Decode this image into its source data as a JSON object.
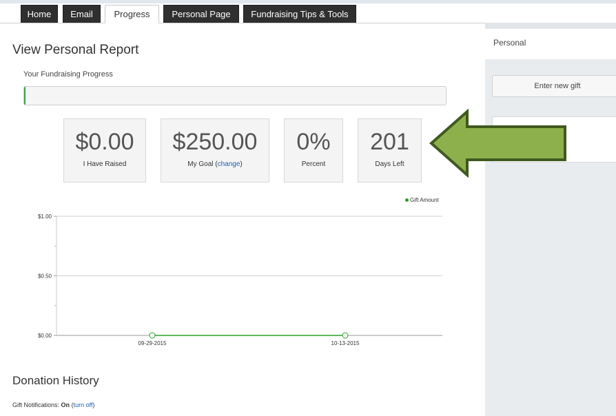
{
  "tabs": [
    {
      "label": "Home",
      "active": false
    },
    {
      "label": "Email",
      "active": false
    },
    {
      "label": "Progress",
      "active": true
    },
    {
      "label": "Personal Page",
      "active": false
    },
    {
      "label": "Fundraising Tips & Tools",
      "active": false
    }
  ],
  "page_title": "View Personal Report",
  "progress": {
    "label": "Your Fundraising Progress",
    "percent_complete": 0
  },
  "stats": {
    "raised": {
      "value": "$0.00",
      "label": "I Have Raised"
    },
    "goal": {
      "value": "$250.00",
      "label_prefix": "My Goal (",
      "link": "change",
      "label_suffix": ")"
    },
    "percent": {
      "value": "0%",
      "label": "Percent"
    },
    "days": {
      "value": "201",
      "label": "Days Left"
    }
  },
  "chart_data": {
    "type": "line",
    "series": [
      {
        "name": "Gift Amount",
        "color": "#2aa02a",
        "x": [
          "09-29-2015",
          "10-13-2015"
        ],
        "values": [
          0.0,
          0.0
        ]
      }
    ],
    "categories": [
      "09-29-2015",
      "10-13-2015"
    ],
    "y_ticks": [
      "$1.00",
      "$0.50",
      "$0.00"
    ],
    "ylim": [
      0,
      1
    ],
    "legend": "top-right",
    "grid": true
  },
  "donation_history": {
    "title": "Donation History",
    "notifications_label": "Gift Notifications:",
    "notifications_state": "On",
    "toggle_link": "turn off",
    "paren_open": "(",
    "paren_close": ")"
  },
  "sidebar": {
    "title": "Personal",
    "enter_gift_button": "Enter new gift"
  },
  "colors": {
    "tab_dark": "#2f2f2f",
    "progress_fill": "#3aa63a",
    "link": "#1f5fb3",
    "arrow_fill": "#8db04c",
    "arrow_border": "#3f5a1e",
    "panel_bg": "#e9ecef"
  }
}
